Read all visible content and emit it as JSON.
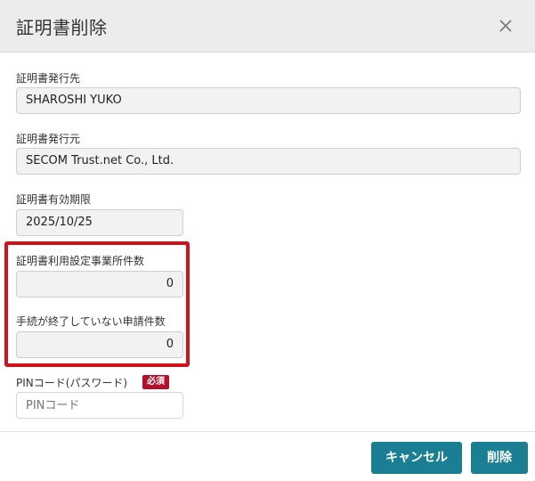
{
  "dialog": {
    "title": "証明書削除",
    "close_icon": "close-icon"
  },
  "fields": {
    "issued_to": {
      "label": "証明書発行先",
      "value": "SHAROSHI YUKO"
    },
    "issuer": {
      "label": "証明書発行元",
      "value": "SECOM Trust.net Co., Ltd."
    },
    "expiry": {
      "label": "証明書有効期限",
      "value": "2025/10/25"
    },
    "office_count": {
      "label": "証明書利用設定事業所件数",
      "value": "0"
    },
    "pending_count": {
      "label": "手続が終了していない申請件数",
      "value": "0"
    },
    "pin": {
      "label": "PINコード(パスワード)",
      "required_badge": "必須",
      "placeholder": "PINコード"
    }
  },
  "buttons": {
    "cancel_label": "キャンセル",
    "delete_label": "削除"
  },
  "colors": {
    "header_bg": "#ececec",
    "accent": "#1a7f92",
    "highlight": "#d0121b",
    "required_badge": "#b3102b"
  }
}
